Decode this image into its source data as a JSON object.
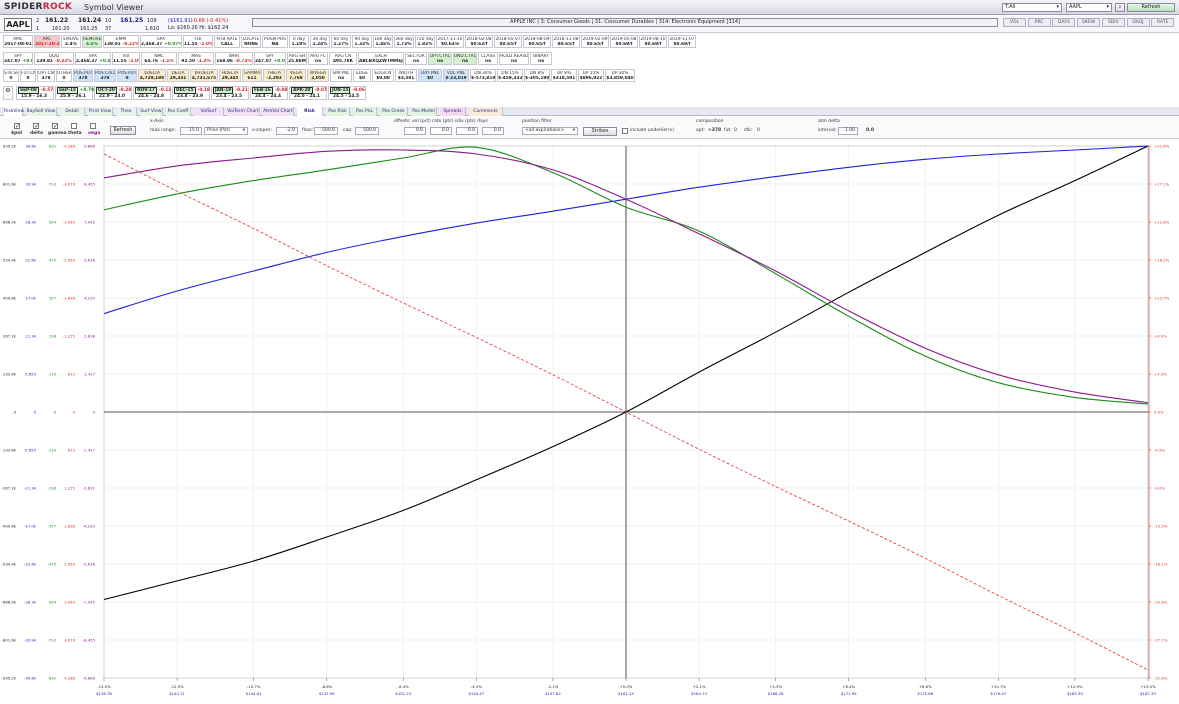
{
  "window": {
    "brand_a": "SPIDER",
    "brand_b": "ROCK",
    "title": "Symbol Viewer",
    "mode_select": "T:All",
    "symbol_select": "AAPL",
    "refresh": "Refresh",
    "icon_a": "⌕",
    "icon_b": "⚑"
  },
  "quote": {
    "symbol": "AAPL",
    "bid_size": "2",
    "bid": "161.22",
    "ask": "161.24",
    "ask_size": "10",
    "last": "161.25",
    "last_size": "109",
    "bid2": "161.20",
    "ask2": "161.25",
    "sz2a": "1",
    "sz2b": "37",
    "sz3": "1,610",
    "change": "($161.91)",
    "change_pct": "-0.66 (-0.41%)",
    "lowhigh": "Lo: $160.26  Hi: $162.24",
    "company": "APPLE INC | 3: Consumer Goods | 31: Consumer Durables | 314: Electronic Equipment [314]"
  },
  "right_buttons": [
    "VOL",
    "PRC",
    "DAYS",
    "SKEW",
    "SDIV",
    "DADJ",
    "RATE"
  ],
  "row2": [
    {
      "l": "AMC",
      "v": "2017-08-01"
    },
    {
      "l": "APC",
      "v": "2017-10-24",
      "hl": "r"
    },
    {
      "l": "EMOVE",
      "v": "2.4%"
    },
    {
      "l": "REMOVE",
      "v": "4.6%",
      "hl": "g"
    },
    {
      "l": "EMM",
      "v": "139.01",
      "c": "-0.22%"
    },
    {
      "l": "SPX",
      "v": "2,468.37",
      "c": "+0.07%"
    },
    {
      "l": "FDI",
      "v": "11.55",
      "c": "-1.0%"
    },
    {
      "l": "HTB RATE",
      "v": "CALL"
    },
    {
      "l": "LOCATE",
      "v": "NONE"
    },
    {
      "l": "POSN POS",
      "v": "NA"
    },
    {
      "l": "0 day",
      "v": "1.18%"
    },
    {
      "l": "30 day",
      "v": "1.24%"
    },
    {
      "l": "60 day",
      "v": "1.27%"
    },
    {
      "l": "90 day",
      "v": "1.32%"
    },
    {
      "l": "180 day",
      "v": "1.46%"
    },
    {
      "l": "360 day",
      "v": "1.73%"
    },
    {
      "l": "720 day",
      "v": "1.82%"
    },
    {
      "l": "2017-11-10",
      "v": "$0.63/e"
    },
    {
      "l": "2018-02-08",
      "v": "$0.63/f"
    },
    {
      "l": "2018-05-07",
      "v": "$0.65/f"
    },
    {
      "l": "2018-08-09",
      "v": "$0.65/f"
    },
    {
      "l": "2018-11-08",
      "v": "$0.65/f"
    },
    {
      "l": "2019-02-09",
      "v": "$0.65/f"
    },
    {
      "l": "2019-05-08",
      "v": "$0.69/f"
    },
    {
      "l": "2019-08-10",
      "v": "$0.69/f"
    },
    {
      "l": "2019-11-07",
      "v": "$0.69/f"
    }
  ],
  "row3": [
    {
      "l": "SPY",
      "v": "247.07",
      "c": "+0.09%"
    },
    {
      "l": "QQQ",
      "v": "139.81",
      "c": "-0.22%"
    },
    {
      "l": "SPX",
      "v": "2,468.37",
      "c": "+0.07%"
    },
    {
      "l": "VIX",
      "v": "11.55",
      "c": "-1.0%"
    },
    {
      "l": "NML",
      "v": "64.76",
      "c": "-1.1%"
    },
    {
      "l": "MAS",
      "v": "92.50",
      "c": "-1.2%"
    },
    {
      "l": "WHR",
      "v": "168.96",
      "c": "-0.73%"
    },
    {
      "l": "SPY",
      "v": "247.07",
      "c": "+0.09%"
    },
    {
      "l": "AVG SH",
      "v": "25.88M"
    },
    {
      "l": "AVG FC",
      "v": "na"
    },
    {
      "l": "AVG CN",
      "v": "495.78K"
    },
    {
      "l": "EXCH",
      "v": "ABCBXQZWTMMEJP"
    },
    {
      "l": "SECTOR",
      "v": "na"
    },
    {
      "l": "OPT.CTRL",
      "v": "na",
      "hl": "g"
    },
    {
      "l": "UND.CTRL",
      "v": "na",
      "hl": "g"
    },
    {
      "l": "CLASS",
      "v": "na"
    },
    {
      "l": "HOLD.REASON",
      "v": "na"
    },
    {
      "l": "BINARY",
      "v": "na"
    }
  ],
  "row4": [
    {
      "l": "STK.SH",
      "v": "0"
    },
    {
      "l": "FUT.CN",
      "v": "0"
    },
    {
      "l": "OPT.CN",
      "v": "378"
    },
    {
      "l": "OTHER",
      "v": "0"
    },
    {
      "l": "POS.PUT",
      "v": "378",
      "hl": "b"
    },
    {
      "l": "POS.CALL",
      "v": "378",
      "hl": "b"
    },
    {
      "l": "POS.PUT",
      "v": "0",
      "hl": "b"
    },
    {
      "l": "$DELTA",
      "v": "4,729,198",
      "hl": "y"
    },
    {
      "l": "DELTA",
      "v": "29,331",
      "hl": "y"
    },
    {
      "l": "$HDELTA",
      "v": "4,731,675",
      "hl": "y"
    },
    {
      "l": "HDELTA",
      "v": "29,345",
      "hl": "y"
    },
    {
      "l": "GAMMA",
      "v": "611",
      "hl": "y"
    },
    {
      "l": "THETA",
      "v": "-2,293",
      "hl": "y"
    },
    {
      "l": "VEGA",
      "v": "7,769",
      "hl": "y"
    },
    {
      "l": "WVEGA",
      "v": "2,050",
      "hl": "y"
    },
    {
      "l": "SIM PNL",
      "v": "na"
    },
    {
      "l": "EDGE",
      "v": "$0"
    },
    {
      "l": "EDG/CN",
      "v": "$0.00"
    },
    {
      "l": "WIDTH",
      "v": "$3,581"
    },
    {
      "l": "DAY PNL",
      "v": "$0",
      "hl": "b"
    },
    {
      "l": "VOL PNL",
      "v": "$-23,019",
      "hl": "b"
    },
    {
      "l": "DN 30%",
      "v": "$-573,819"
    },
    {
      "l": "DN 15%",
      "v": "$-459,332"
    },
    {
      "l": "DN 8%",
      "v": "$-305,190"
    },
    {
      "l": "UP 8%",
      "v": "$318,591"
    },
    {
      "l": "UP 15%",
      "v": "$896,922"
    },
    {
      "l": "UP 30%",
      "v": "$3,859,040"
    }
  ],
  "row5": [
    {
      "exp": "SEP-08",
      "chg": "-0.57",
      "rng": "15.9 - 16.3"
    },
    {
      "exp": "SEP-15",
      "chg": "+0.78",
      "rng": "25.9 - 26.1"
    },
    {
      "exp": "OCT-20",
      "chg": "-0.28",
      "rng": "22.9 - 23.0"
    },
    {
      "exp": "NOV-17",
      "chg": "-0.11",
      "rng": "24.6 - 24.8"
    },
    {
      "exp": "DEC-15",
      "chg": "-0.18",
      "rng": "23.8 - 23.9"
    },
    {
      "exp": "JAN-19",
      "chg": "-0.21",
      "rng": "23.4 - 23.5"
    },
    {
      "exp": "FEB-16",
      "chg": "-0.08",
      "rng": "24.4 - 24.4"
    },
    {
      "exp": "APR-20",
      "chg": "-0.07",
      "rng": "24.0 - 24.1"
    },
    {
      "exp": "JUN-15",
      "chg": "-0.06",
      "rng": "24.5 - 24.5"
    }
  ],
  "tabs": [
    "RiskView",
    "BaySell View",
    "Detail View",
    "Print View",
    "Theo View",
    "Surf View",
    "Pos Coeff",
    "VolSurf Chart",
    "VolTerm Chart",
    "AtmVol Chart",
    "Risk Chart",
    "Pos Risk",
    "Pos PnL",
    "Pos Greek",
    "Pos Model",
    "Spreads",
    "Comments"
  ],
  "controls": {
    "xaxis": "x-Axis",
    "maxrange_label": "max range:",
    "maxrange": "15.0",
    "pricepct": "Price (Pct)",
    "vslopes_label": "v-slopes:",
    "vslopes": "-2.0",
    "floor_label": "floor:",
    "floor": "-500.0",
    "cap_label": "cap:",
    "cap": "500.0",
    "shift_label": "offsets: vol (pct) rate (pts) sdiv (pts) days",
    "shift_vol": "0.0",
    "shift_rate": "0.0",
    "shift_sdiv": "0.0",
    "shift_days": "0.0",
    "posfilter_label": "position filter",
    "posfilter": "<all expirations>",
    "strikes": "Strikes",
    "include_underliers": "include underlier(s)",
    "comp_label": "composition",
    "comp_opt_l": "opt:",
    "comp_opt": "+378",
    "comp_fut_l": "fut:",
    "comp_fut": "0",
    "comp_stk_l": "stk:",
    "comp_stk": "0",
    "atmdelta_label": "atm delta",
    "interval_label": "interval:",
    "interval": "1.00",
    "interval_val": "0.0",
    "refresh": "Refresh"
  },
  "series_checks": [
    {
      "name": "$pnl",
      "checked": true
    },
    {
      "name": "delta",
      "checked": true
    },
    {
      "name": "gamma",
      "checked": true
    },
    {
      "name": "theta",
      "checked": false
    },
    {
      "name": "vega",
      "checked": false
    }
  ],
  "colors": {
    "pnl": "#000000",
    "delta": "#2020dd",
    "gamma": "#1a8a1a",
    "theta": "#e03030",
    "vega": "#8a1a8a"
  },
  "chart_data": {
    "type": "line",
    "x": [
      -15,
      -12.9,
      -10.7,
      -8.6,
      -6.4,
      -4.3,
      -2.1,
      0,
      2.1,
      4.3,
      6.4,
      8.6,
      10.7,
      12.9,
      15
    ],
    "x_tick_labels": [
      "-15.0%",
      "-12.9%",
      "-10.7%",
      "-8.6%",
      "-6.4%",
      "-4.3%",
      "-2.1%",
      "+0.0%",
      "+2.1%",
      "+4.3%",
      "+6.4%",
      "+8.6%",
      "+10.7%",
      "+12.9%",
      "+15.0%"
    ],
    "x_price_labels": [
      "$136.78",
      "$140.71",
      "$144.61",
      "$147.99",
      "$151.23",
      "$154.47",
      "$157.82",
      "$161.24",
      "$164.73",
      "$168.28",
      "$171.99",
      "$175.66",
      "$179.47",
      "$183.39",
      "$187.33"
    ],
    "y_rows": [
      {
        "pnl": "935.2k",
        "delta": "39.6k",
        "gamma": "832",
        "theta": "-4,288",
        "vega": "9,866"
      },
      {
        "pnl": "801.6k",
        "delta": "33.9k",
        "gamma": "713",
        "theta": "-3,676",
        "vega": "8,455"
      },
      {
        "pnl": "668.0k",
        "delta": "28.3k",
        "gamma": "594",
        "theta": "-3,063",
        "vega": "7,045"
      },
      {
        "pnl": "534.4k",
        "delta": "22.6k",
        "gamma": "475",
        "theta": "-2,450",
        "vega": "5,636"
      },
      {
        "pnl": "400.8k",
        "delta": "17.0k",
        "gamma": "357",
        "theta": "-1,838",
        "vega": "4,230"
      },
      {
        "pnl": "267.2k",
        "delta": "11.3k",
        "gamma": "238",
        "theta": "-1,225",
        "vega": "2,818"
      },
      {
        "pnl": "133.6k",
        "delta": "5.655",
        "gamma": "119",
        "theta": "-613",
        "vega": "1,417"
      },
      {
        "pnl": "0",
        "delta": "0",
        "gamma": "0",
        "theta": "0",
        "vega": "0"
      },
      {
        "pnl": "-133.6k",
        "delta": "-5.655",
        "gamma": "-119",
        "theta": "613",
        "vega": "-1,417"
      },
      {
        "pnl": "-267.2k",
        "delta": "-11.3k",
        "gamma": "-238",
        "theta": "1,225",
        "vega": "-2,831"
      },
      {
        "pnl": "-400.8k",
        "delta": "-17.0k",
        "gamma": "-357",
        "theta": "1,838",
        "vega": "-4,230"
      },
      {
        "pnl": "-534.4k",
        "delta": "-22.6k",
        "gamma": "-475",
        "theta": "2,450",
        "vega": "-5,636"
      },
      {
        "pnl": "-668.0k",
        "delta": "-28.3k",
        "gamma": "-594",
        "theta": "3,063",
        "vega": "-7,045"
      },
      {
        "pnl": "-801.6k",
        "delta": "-33.9k",
        "gamma": "-713",
        "theta": "3,676",
        "vega": "-8,455"
      },
      {
        "pnl": "-935.2k",
        "delta": "-39.6k",
        "gamma": "-832",
        "theta": "4,288",
        "vega": "-9,866"
      }
    ],
    "y_right_labels": [
      "+31.6%",
      "+27.1%",
      "+22.6%",
      "+18.1%",
      "+13.5%",
      "+9.0%",
      "+4.5%",
      "0.0%",
      "-4.5%",
      "-9.0%",
      "-13.5%",
      "-18.1%",
      "-22.6%",
      "-27.1%",
      "-31.6%"
    ],
    "series": [
      {
        "name": "$pnl",
        "values": [
          -0.705,
          -0.635,
          -0.56,
          -0.47,
          -0.37,
          -0.255,
          -0.13,
          0,
          0.15,
          0.3,
          0.45,
          0.6,
          0.74,
          0.87,
          1.0
        ]
      },
      {
        "name": "delta",
        "values": [
          0.37,
          0.455,
          0.53,
          0.6,
          0.66,
          0.71,
          0.755,
          0.8,
          0.845,
          0.885,
          0.92,
          0.95,
          0.97,
          0.985,
          1.0
        ]
      },
      {
        "name": "gamma",
        "values": [
          0.76,
          0.82,
          0.87,
          0.91,
          0.955,
          0.995,
          0.9,
          0.77,
          0.68,
          0.52,
          0.36,
          0.21,
          0.11,
          0.055,
          0.03
        ]
      },
      {
        "name": "vega",
        "values": [
          0.88,
          0.925,
          0.955,
          0.98,
          0.985,
          0.97,
          0.91,
          0.8,
          0.67,
          0.53,
          0.38,
          0.24,
          0.14,
          0.075,
          0.035
        ]
      },
      {
        "name": "theta",
        "values": [
          0.97,
          0.83,
          0.69,
          0.55,
          0.41,
          0.28,
          0.14,
          0,
          -0.14,
          -0.28,
          -0.41,
          -0.55,
          -0.69,
          -0.83,
          -0.97
        ]
      }
    ],
    "ylim": [
      -1,
      1
    ],
    "xlim": [
      -15,
      15
    ]
  }
}
